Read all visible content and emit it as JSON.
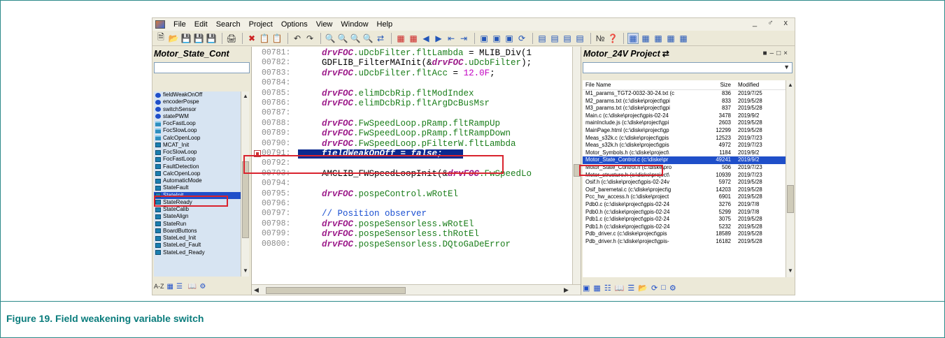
{
  "menubar": {
    "items": [
      "File",
      "Edit",
      "Search",
      "Project",
      "Options",
      "View",
      "Window",
      "Help"
    ],
    "window_controls": "_ ♂ x"
  },
  "left_panel": {
    "title": "Motor_State_Cont",
    "symbols": [
      {
        "label": "fieldWeakOnOff",
        "icon": "variable-icon"
      },
      {
        "label": "encoderPospe",
        "icon": "variable-icon"
      },
      {
        "label": "switchSensor",
        "icon": "variable-icon"
      },
      {
        "label": "statePWM",
        "icon": "variable-icon"
      },
      {
        "label": "FocFastLoop",
        "icon": "folder-icon"
      },
      {
        "label": "FocSlowLoop",
        "icon": "folder-icon"
      },
      {
        "label": "CalcOpenLoop",
        "icon": "folder-icon"
      },
      {
        "label": "MCAT_Init",
        "icon": "function-icon"
      },
      {
        "label": "FocSlowLoop",
        "icon": "function-icon"
      },
      {
        "label": "FocFastLoop",
        "icon": "function-icon"
      },
      {
        "label": "FaultDetection",
        "icon": "function-icon"
      },
      {
        "label": "CalcOpenLoop",
        "icon": "function-icon"
      },
      {
        "label": "AutomaticMode",
        "icon": "function-icon"
      },
      {
        "label": "StateFault",
        "icon": "function-icon"
      },
      {
        "label": "StateInit",
        "icon": "function-icon"
      },
      {
        "label": "StateReady",
        "icon": "function-icon"
      },
      {
        "label": "StateCalib",
        "icon": "function-icon"
      },
      {
        "label": "StateAlign",
        "icon": "function-icon"
      },
      {
        "label": "StateRun",
        "icon": "function-icon"
      },
      {
        "label": "BoardButtons",
        "icon": "function-icon"
      },
      {
        "label": "StateLed_Init",
        "icon": "function-icon"
      },
      {
        "label": "StateLed_Fault",
        "icon": "function-icon"
      },
      {
        "label": "StateLed_Ready",
        "icon": "function-icon"
      }
    ],
    "selected_index": 14,
    "bottom_label": "A-Z"
  },
  "editor": {
    "lines": [
      {
        "num": "00781:",
        "parts": [
          [
            "kw",
            "drvFOC"
          ],
          [
            "mbr",
            ".uDcbFilter.fltLambda"
          ],
          [
            "txt",
            " = MLIB_Div(1"
          ]
        ]
      },
      {
        "num": "00782:",
        "parts": [
          [
            "txt",
            "GDFLIB_FilterMAInit(&"
          ],
          [
            "kw",
            "drvFOC"
          ],
          [
            "mbr",
            ".uDcbFilter"
          ],
          [
            "txt",
            ");"
          ]
        ]
      },
      {
        "num": "00783:",
        "parts": [
          [
            "kw",
            "drvFOC"
          ],
          [
            "mbr",
            ".uDcbFilter.fltAcc"
          ],
          [
            "txt",
            " = "
          ],
          [
            "num",
            "12.0F"
          ],
          [
            "txt",
            ";"
          ]
        ]
      },
      {
        "num": "00784:",
        "parts": []
      },
      {
        "num": "00785:",
        "parts": [
          [
            "kw",
            "drvFOC"
          ],
          [
            "mbr",
            ".elimDcbRip.fltModIndex"
          ]
        ]
      },
      {
        "num": "00786:",
        "parts": [
          [
            "kw",
            "drvFOC"
          ],
          [
            "mbr",
            ".elimDcbRip.fltArgDcBusMsr"
          ]
        ]
      },
      {
        "num": "00787:",
        "parts": []
      },
      {
        "num": "00788:",
        "parts": [
          [
            "kw",
            "drvFOC"
          ],
          [
            "mbr",
            ".FwSpeedLoop.pRamp.fltRampUp"
          ]
        ]
      },
      {
        "num": "00789:",
        "parts": [
          [
            "kw",
            "drvFOC"
          ],
          [
            "mbr",
            ".FwSpeedLoop.pRamp.fltRampDown"
          ]
        ]
      },
      {
        "num": "00790:",
        "parts": [
          [
            "kw",
            "drvFOC"
          ],
          [
            "mbr",
            ".FwSpeedLoop.pFilterW.fltLambda"
          ]
        ]
      },
      {
        "num": "00791:",
        "parts": [],
        "highlight": "fieldWeakOnOff = false;"
      },
      {
        "num": "00792:",
        "parts": []
      },
      {
        "num": "00793:",
        "parts": [
          [
            "txt",
            "AMCLIB_FWSpeedLoopInit(&"
          ],
          [
            "kw",
            "drvFOC"
          ],
          [
            "mbr",
            ".FwSpeedLo"
          ]
        ]
      },
      {
        "num": "00794:",
        "parts": []
      },
      {
        "num": "00795:",
        "parts": [
          [
            "kw",
            "drvFOC"
          ],
          [
            "mbr",
            ".pospeControl.wRotEl"
          ]
        ]
      },
      {
        "num": "00796:",
        "parts": []
      },
      {
        "num": "00797:",
        "parts": [
          [
            "cmt",
            "// Position observer"
          ]
        ]
      },
      {
        "num": "00798:",
        "parts": [
          [
            "kw",
            "drvFOC"
          ],
          [
            "mbr",
            ".pospeSensorless.wRotEl"
          ]
        ]
      },
      {
        "num": "00799:",
        "parts": [
          [
            "kw",
            "drvFOC"
          ],
          [
            "mbr",
            ".pospeSensorless.thRotEl"
          ]
        ]
      },
      {
        "num": "00800:",
        "parts": [
          [
            "kw",
            "drvFOC"
          ],
          [
            "mbr",
            ".pospeSensorless.DQtoGaDeError"
          ]
        ]
      }
    ]
  },
  "right_panel": {
    "title": "Motor_24V Project",
    "columns": {
      "name": "File Name",
      "size": "Size",
      "modified": "Modified"
    },
    "files": [
      {
        "name": "M1_params_TGT2-0032-30-24.txt (c",
        "size": "836",
        "modified": "2019/7/25"
      },
      {
        "name": "M2_params.txt (c:\\diske\\project\\gpi",
        "size": "833",
        "modified": "2019/5/28"
      },
      {
        "name": "M3_params.txt (c:\\diske\\project\\gpi",
        "size": "837",
        "modified": "2019/5/28"
      },
      {
        "name": "Main.c (c:\\diske\\project\\gpis-02-24",
        "size": "3478",
        "modified": "2019/9/2"
      },
      {
        "name": "mainInclude.js (c:\\diske\\project\\gpi",
        "size": "2603",
        "modified": "2019/5/28"
      },
      {
        "name": "MainPage.html (c:\\diske\\project\\gp",
        "size": "12299",
        "modified": "2019/5/28"
      },
      {
        "name": "Meas_s32k.c (c:\\diske\\project\\gpis",
        "size": "12523",
        "modified": "2019/7/23"
      },
      {
        "name": "Meas_s32k.h (c:\\diske\\project\\gpis",
        "size": "4972",
        "modified": "2019/7/23"
      },
      {
        "name": "Motor_Symbols.h (c:\\diske\\project\\",
        "size": "1184",
        "modified": "2019/9/2"
      },
      {
        "name": "Motor_State_Control.c (c:\\diske\\pr",
        "size": "49241",
        "modified": "2019/9/2"
      },
      {
        "name": "Motor_State_Control.h (c:\\diske\\pro",
        "size": "506",
        "modified": "2019/7/23"
      },
      {
        "name": "Motor_structure.h (c:\\diske\\project\\",
        "size": "10939",
        "modified": "2019/7/23"
      },
      {
        "name": "Osif.h (c:\\diske\\project\\gpis-02-24v",
        "size": "5972",
        "modified": "2019/5/28"
      },
      {
        "name": "Osif_baremetal.c (c:\\diske\\project\\g",
        "size": "14203",
        "modified": "2019/5/28"
      },
      {
        "name": "Pcc_hw_access.h (c:\\diske\\project",
        "size": "6901",
        "modified": "2019/5/28"
      },
      {
        "name": "Pdb0.c (c:\\diske\\project\\gpis-02-24",
        "size": "3276",
        "modified": "2019/7/8"
      },
      {
        "name": "Pdb0.h (c:\\diske\\project\\gpis-02-24",
        "size": "5299",
        "modified": "2019/7/8"
      },
      {
        "name": "Pdb1.c (c:\\diske\\project\\gpis-02-24",
        "size": "3075",
        "modified": "2019/5/28"
      },
      {
        "name": "Pdb1.h (c:\\diske\\project\\gpis-02-24",
        "size": "5232",
        "modified": "2019/5/28"
      },
      {
        "name": "Pdb_driver.c (c:\\diske\\project\\gpis",
        "size": "18589",
        "modified": "2019/5/28"
      },
      {
        "name": "Pdb_driver.h (c:\\diske\\project\\gpis-",
        "size": "16182",
        "modified": "2019/5/28"
      }
    ],
    "selected_index": 9
  },
  "caption": "Figure 19. Field weakening variable switch",
  "colors": {
    "accent": "#0a7c7c",
    "callout": "#d9232e",
    "selection": "#1f4fc9"
  }
}
